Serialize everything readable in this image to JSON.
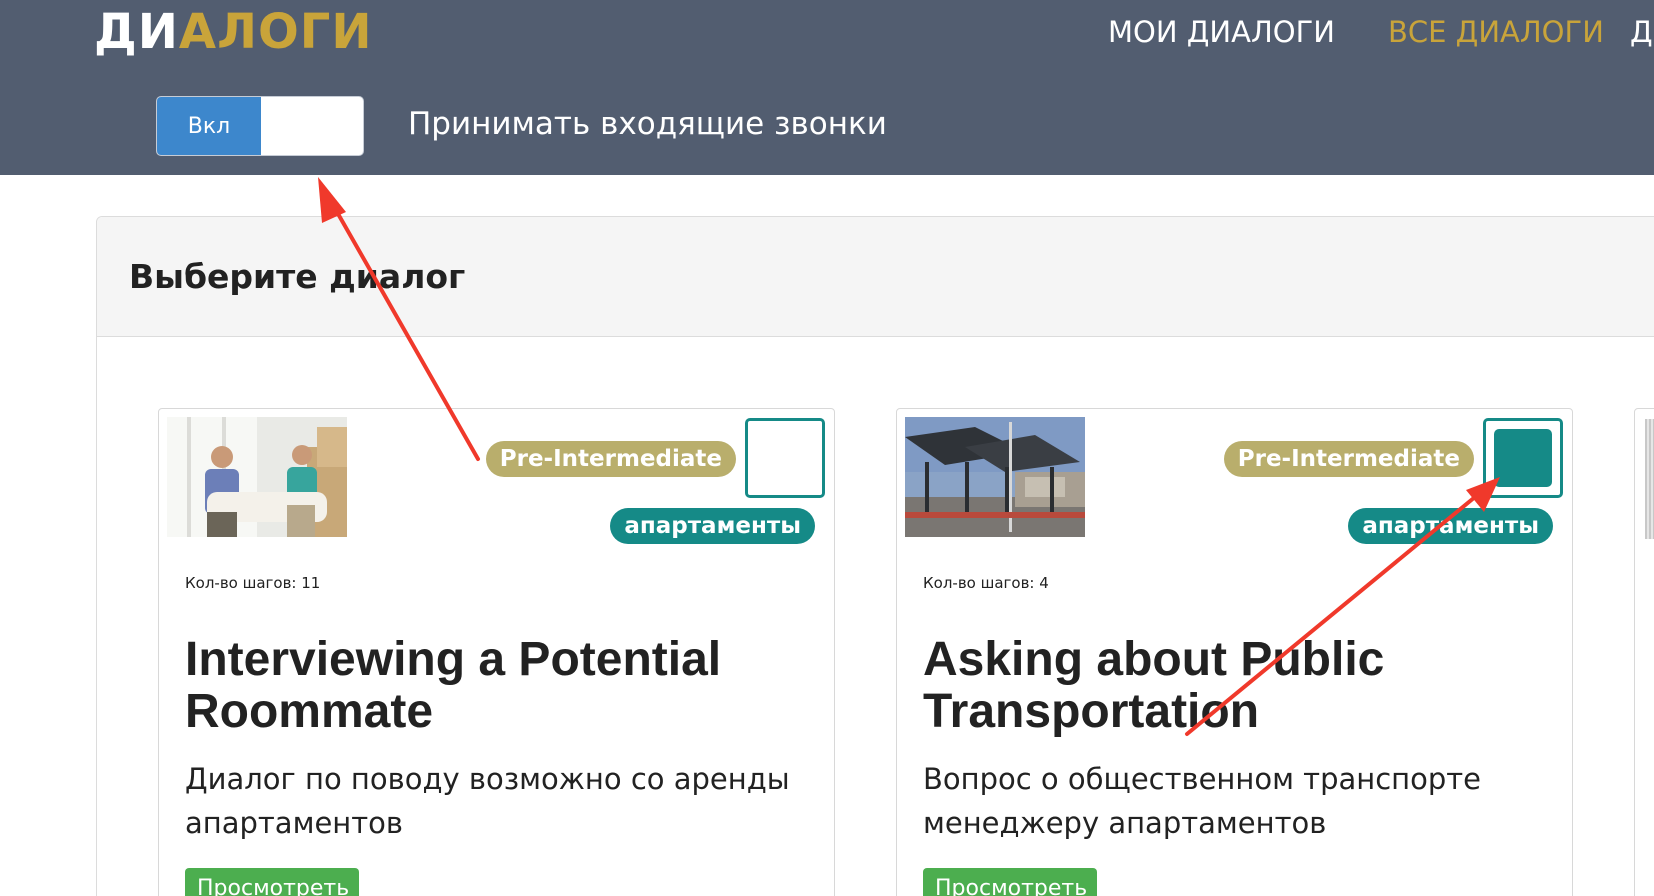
{
  "header": {
    "logo_part1": "ДИ",
    "logo_part2": "АЛОГИ",
    "nav": [
      "МОИ ДИАЛОГИ",
      "ВСЕ ДИАЛОГИ",
      "Д"
    ],
    "toggle_on_label": "Вкл",
    "toggle_caption": "Принимать входящие звонки",
    "toggle_state": "on"
  },
  "panel": {
    "title": "Выберите диалог"
  },
  "cards": [
    {
      "level": "Pre-Intermediate",
      "tag": "апартаменты",
      "steps": "Кол-во шагов: 11",
      "title": "Interviewing a Potential Roommate",
      "description": "Диалог по поводу возможно со аренды апартаментов",
      "button": "Просмотреть",
      "selected": false,
      "image_icon": "roommates-photo-icon"
    },
    {
      "level": "Pre-Intermediate",
      "tag": "апартаменты",
      "steps": "Кол-во шагов: 4",
      "title": "Asking about Public Transportation",
      "description": "Вопрос о общественном транспорте менеджеру апартаментов",
      "button": "Просмотреть",
      "selected": true,
      "image_icon": "bus-station-photo-icon"
    }
  ],
  "colors": {
    "header_bg": "#525d70",
    "accent_gold": "#c9a43a",
    "toggle_blue": "#3d87cc",
    "level_badge": "#b9ae6c",
    "tag_teal": "#158a87",
    "button_green": "#4cae4f",
    "annotation_red": "#f0392b"
  }
}
